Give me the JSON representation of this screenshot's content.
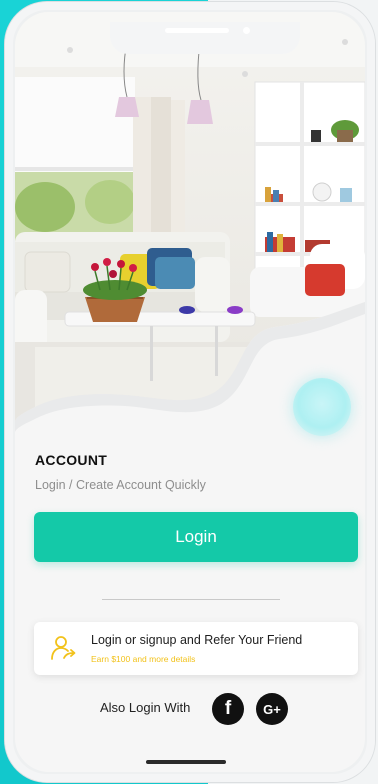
{
  "account": {
    "title": "ACCOUNT",
    "subtitle": "Login / Create Account Quickly"
  },
  "login_button": {
    "label": "Login"
  },
  "refer": {
    "title": "Login or signup and Refer Your Friend",
    "subtitle": "Earn $100 and more details"
  },
  "social": {
    "label": "Also Login With",
    "facebook_glyph": "f",
    "google_glyph": "G+"
  },
  "icons": {
    "refer": "user-add-icon",
    "facebook": "facebook-icon",
    "google": "google-plus-icon"
  },
  "colors": {
    "accent": "#14c9a8",
    "refer_highlight": "#f2c21b",
    "backdrop": "#19d3d6"
  }
}
